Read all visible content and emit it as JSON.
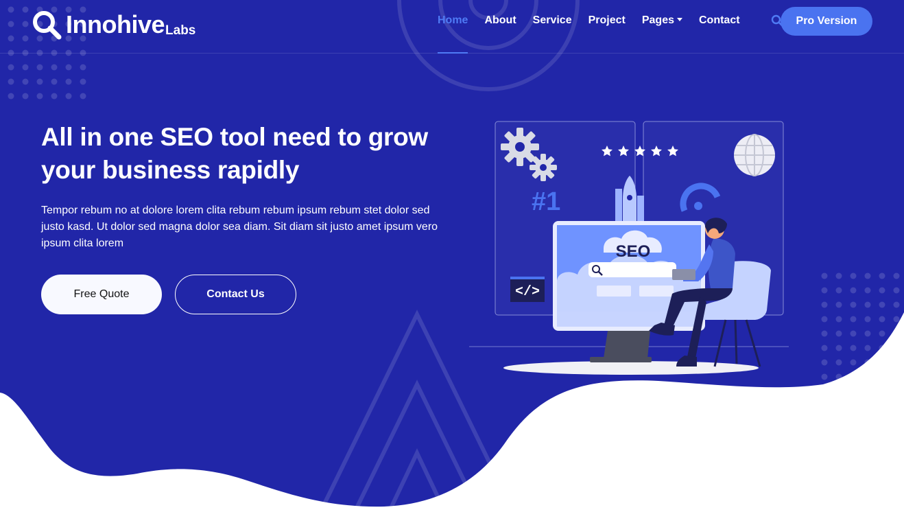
{
  "brand": {
    "name": "Innohive",
    "suffix": "Labs"
  },
  "nav": {
    "items": [
      {
        "label": "Home",
        "active": true
      },
      {
        "label": "About"
      },
      {
        "label": "Service"
      },
      {
        "label": "Project"
      },
      {
        "label": "Pages",
        "dropdown": true
      },
      {
        "label": "Contact"
      }
    ],
    "search_icon": "search-icon",
    "cta": "Pro Version"
  },
  "hero": {
    "headline_line1": "All in one SEO tool need to grow",
    "headline_line2": "your business rapidly",
    "description": "Tempor rebum no at dolore lorem clita rebum rebum ipsum rebum stet dolor sed justo kasd. Ut dolor sed magna dolor sea diam. Sit diam sit justo amet ipsum vero ipsum clita lorem",
    "primary_button": "Free Quote",
    "secondary_button": "Contact Us"
  },
  "illustration": {
    "monitor_text": "SEO",
    "rank_text": "#1",
    "code_text": "</>",
    "stars": 5
  },
  "colors": {
    "hero_bg": "#2126a8",
    "accent": "#4a73f0",
    "white": "#ffffff"
  }
}
